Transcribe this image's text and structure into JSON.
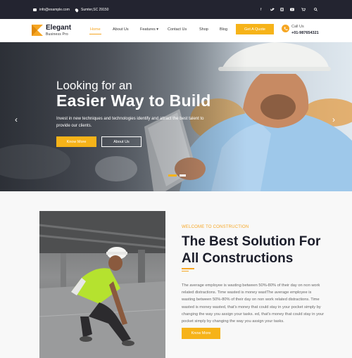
{
  "topbar": {
    "email": "info@example.com",
    "address": "Sumter,SC 29150",
    "social_icons": [
      "facebook-icon",
      "twitter-icon",
      "instagram-icon",
      "youtube-icon",
      "cart-icon",
      "search-icon"
    ]
  },
  "header": {
    "brand": "Elegant",
    "tagline": "Business Pro",
    "nav": [
      "Home",
      "About Us",
      "Features",
      "Contact Us",
      "Shop",
      "Blog"
    ],
    "active_nav": "Home",
    "quote_label": "Get A Quote",
    "call_label": "Call Us",
    "call_number": "+01-987654321",
    "accent": "#f6a623"
  },
  "hero": {
    "line1": "Looking for an",
    "line2": "Easier Way to Build",
    "desc": "Invest in new techniques and technologies identify and attract the best talent to provide our clients.",
    "btn_primary": "Know More",
    "btn_secondary": "About Us",
    "arrow_left": "‹",
    "arrow_right": "›"
  },
  "about": {
    "welcome": "WELCOME TO CONSTRUCTION",
    "title": "The Best Solution For All Constructions",
    "paragraph": "The average employee is wasting between 50%-80% of their day on non work related distractions. Time wasted is money wastThe average employee is wasting between 50%-80% of their day on non work related distractions. Time wasted is money wasted, that's money that could stay in your pocket simply by changing the way you assign your tasks. ed, that's money that could stay in your pocket simply by changing the way you assign your tasks.",
    "btn": "Know More"
  }
}
